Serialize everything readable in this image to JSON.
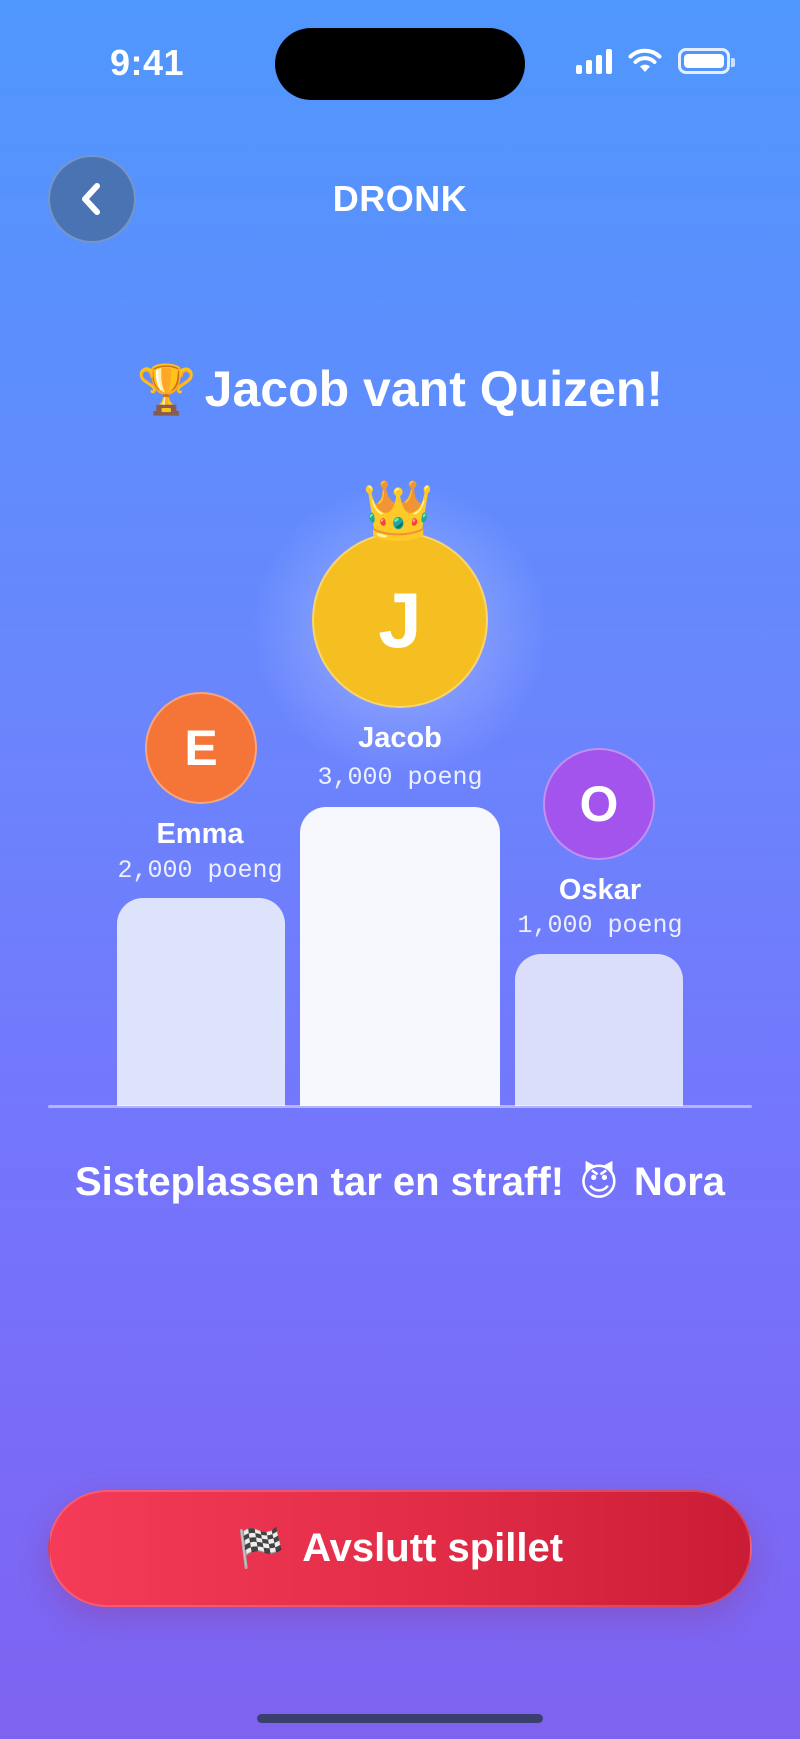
{
  "status_bar": {
    "time": "9:41"
  },
  "header": {
    "title": "DRONK",
    "back_icon": "chevron-left-icon"
  },
  "winner": {
    "trophy_emoji": "🏆",
    "text": "Jacob vant Quizen!"
  },
  "podium": {
    "first": {
      "initial": "J",
      "name": "Jacob",
      "points": "3,000 poeng",
      "color": "#f5bf22",
      "crown_emoji": "👑"
    },
    "second": {
      "initial": "E",
      "name": "Emma",
      "points": "2,000 poeng",
      "color": "#f47537"
    },
    "third": {
      "initial": "O",
      "name": "Oskar",
      "points": "1,000 poeng",
      "color": "#a254ec"
    }
  },
  "penalty": {
    "text": "Sisteplassen tar en straff!",
    "emoji": "😈",
    "name": "Nora"
  },
  "end_button": {
    "flag_emoji": "🏁",
    "label": "Avslutt spillet"
  }
}
